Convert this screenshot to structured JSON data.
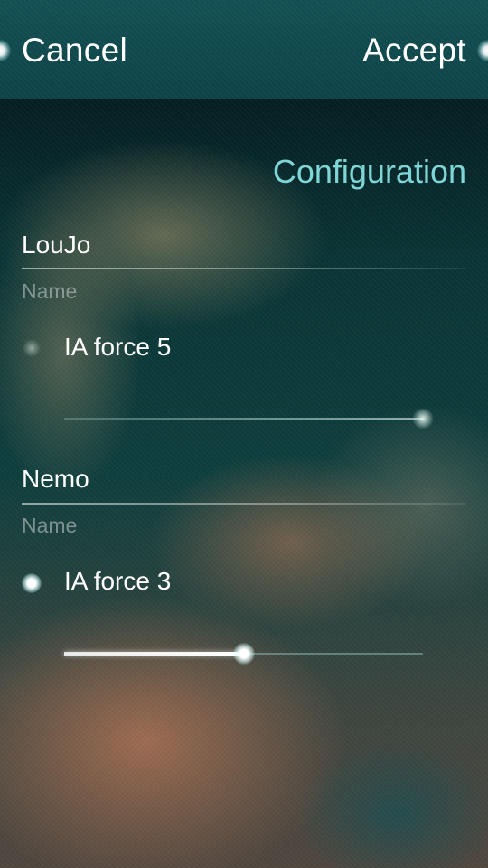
{
  "header": {
    "cancel_label": "Cancel",
    "accept_label": "Accept"
  },
  "page": {
    "title": "Configuration"
  },
  "players": [
    {
      "name_value": "LouJo",
      "name_label": "Name",
      "ia_label": "IA force 5",
      "ia_enabled": false,
      "ia_level_fraction": 1.0
    },
    {
      "name_value": "Nemo",
      "name_label": "Name",
      "ia_label": "IA force 3",
      "ia_enabled": true,
      "ia_level_fraction": 0.5
    }
  ],
  "colors": {
    "header_bg": "#145558",
    "title_accent": "#7fd6d6"
  }
}
